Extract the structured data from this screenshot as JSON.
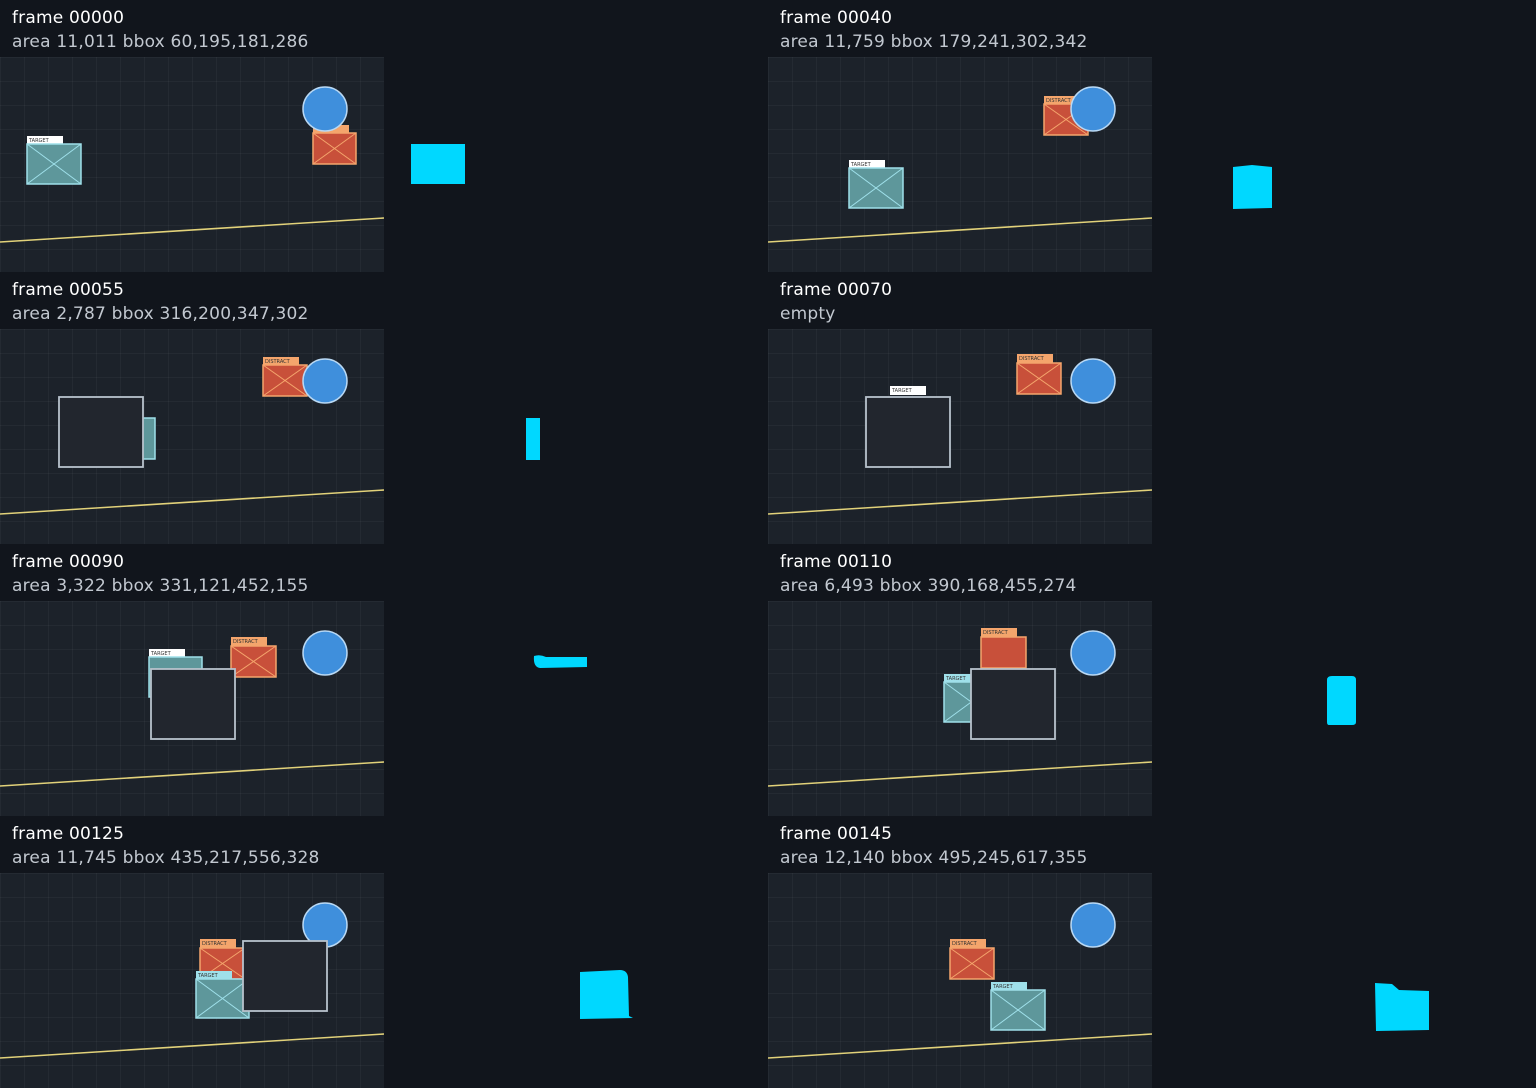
{
  "colors": {
    "background": "#11151c",
    "panel": "#1c222a",
    "target_fill": "#5e979b",
    "target_stroke": "#9fe0ea",
    "distractor_fill": "#c8503a",
    "distractor_stroke": "#f4a56c",
    "occluder_fill": "#22262e",
    "occluder_stroke": "#b8c2cc",
    "ball": "#3f8fdc",
    "floor_line": "#e2d27a",
    "mask": "#00d8ff"
  },
  "labels": {
    "target": "TARGET",
    "distractor": "DISTRACT"
  },
  "frames": [
    {
      "title": "frame 00000",
      "info": "area 11,011  bbox 60,195,181,286"
    },
    {
      "title": "frame 00040",
      "info": "area 11,759  bbox 179,241,302,342"
    },
    {
      "title": "frame 00055",
      "info": "area 2,787  bbox 316,200,347,302"
    },
    {
      "title": "frame 00070",
      "info": "empty"
    },
    {
      "title": "frame 00090",
      "info": "area 3,322  bbox 331,121,452,155"
    },
    {
      "title": "frame 00110",
      "info": "area 6,493  bbox 390,168,455,274"
    },
    {
      "title": "frame 00125",
      "info": "area 11,745  bbox 435,217,556,328"
    },
    {
      "title": "frame 00145",
      "info": "area 12,140  bbox 495,245,617,355"
    }
  ]
}
